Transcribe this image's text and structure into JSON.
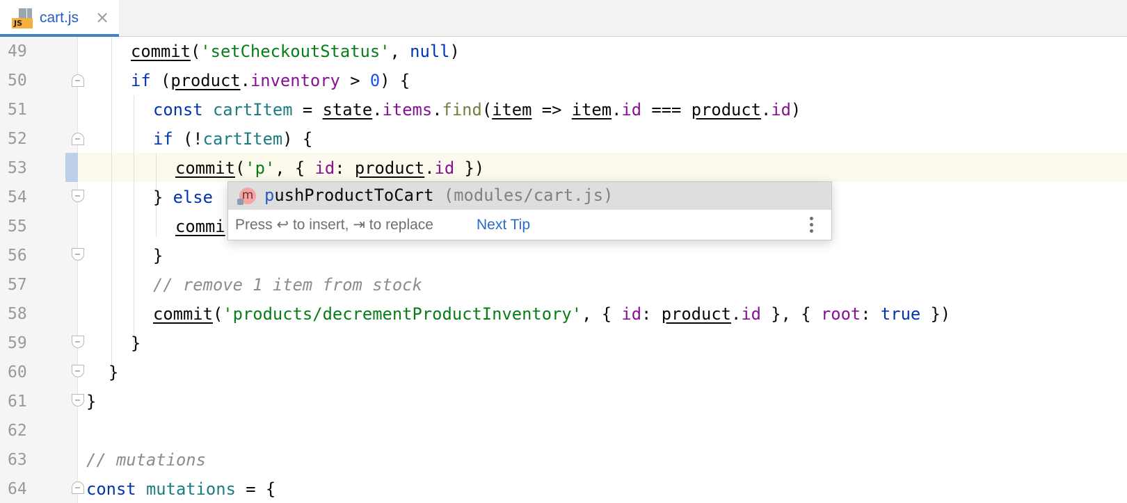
{
  "tab": {
    "file_name": "cart.js",
    "icon_badge": "JS"
  },
  "gutter": {
    "line_numbers": [
      "49",
      "50",
      "51",
      "52",
      "53",
      "54",
      "55",
      "56",
      "57",
      "58",
      "59",
      "60",
      "61",
      "62",
      "63",
      "64"
    ]
  },
  "code": {
    "l49": {
      "fn": "commit",
      "p1": "(",
      "str": "'setCheckoutStatus'",
      "p2": ", ",
      "kw": "null",
      "p3": ")"
    },
    "l50": {
      "kw": "if",
      "p1": " (",
      "obj": "product",
      "dot": ".",
      "prop": "inventory",
      "op": " > ",
      "num": "0",
      "p2": ") {"
    },
    "l51": {
      "kw": "const",
      "sp": " ",
      "var": "cartItem",
      "eq": " = ",
      "state": "state",
      "d1": ".",
      "items": "items",
      "d2": ".",
      "find": "find",
      "p1": "(",
      "item1": "item",
      "arrow": " => ",
      "item2": "item",
      "d3": ".",
      "id1": "id",
      "eqq": " === ",
      "product": "product",
      "d4": ".",
      "id2": "id",
      "p2": ")"
    },
    "l52": {
      "kw": "if",
      "p1": " (!",
      "var": "cartItem",
      "p2": ") {"
    },
    "l53": {
      "fn": "commit",
      "p1": "(",
      "str": "'p'",
      "p2": ", { ",
      "key": "id",
      "colon": ": ",
      "obj": "product",
      "dot": ".",
      "prop": "id",
      "p3": " })"
    },
    "l54": {
      "brace": "} ",
      "kw": "else"
    },
    "l55": {
      "fn": "commi"
    },
    "l56": {
      "brace": "}"
    },
    "l57": {
      "cmt": "// remove 1 item from stock"
    },
    "l58": {
      "fn": "commit",
      "p1": "(",
      "str": "'products/decrementProductInventory'",
      "p2": ", { ",
      "key": "id",
      "colon": ": ",
      "obj": "product",
      "dot": ".",
      "prop": "id",
      "p3": " }, { ",
      "key2": "root",
      "colon2": ": ",
      "kw": "true",
      "p4": " })"
    },
    "l59": {
      "brace": "}"
    },
    "l60": {
      "brace": "}"
    },
    "l61": {
      "brace": "}"
    },
    "l63": {
      "cmt": "// mutations"
    },
    "l64": {
      "kw": "const",
      "sp": " ",
      "var": "mutations",
      "rest": " = {"
    }
  },
  "completion": {
    "icon_letter": "m",
    "item_match": "p",
    "item_rest": "ushProductToCart",
    "item_detail": "(modules/cart.js)",
    "hint": "Press ↩ to insert, ⇥ to replace",
    "next_tip": "Next Tip"
  },
  "colors": {
    "keyword": "#0033b3",
    "string": "#067d17",
    "property": "#871094",
    "variable": "#1b7c83",
    "number": "#1750eb",
    "comment": "#8c8c8c",
    "accent": "#4083c9",
    "caret_row": "#fcfaed"
  }
}
